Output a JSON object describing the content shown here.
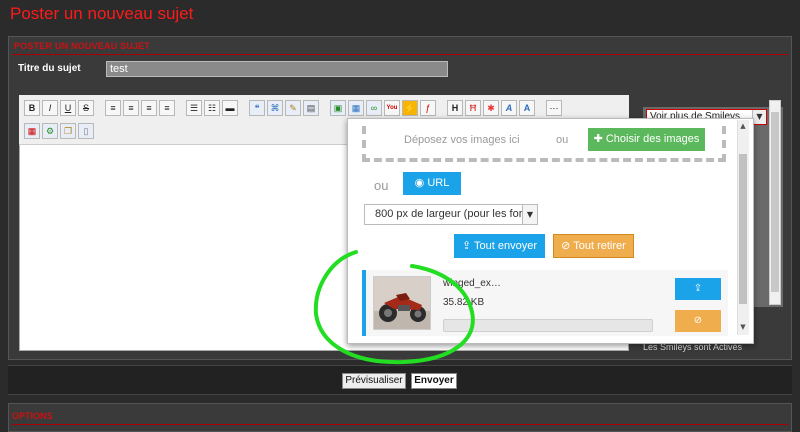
{
  "header": {
    "title": "Poster un nouveau sujet"
  },
  "post_section": {
    "heading": "POSTER UN NOUVEAU SUJET"
  },
  "subject": {
    "label": "Titre du sujet",
    "value": "test"
  },
  "toolbar": {
    "row1": [
      "B",
      "I",
      "U",
      "S",
      "align-left",
      "align-center",
      "align-right",
      "justify",
      "bulleted-list",
      "numbered-list",
      "horizontal-rule",
      "quote",
      "code",
      "spoiler",
      "hide",
      "image",
      "host-image",
      "link",
      "youtube",
      "flash",
      "dailymotion",
      "H",
      "table",
      "color",
      "A",
      "font-size",
      "more"
    ],
    "row2": [
      "date",
      "gadgets",
      "copy-paste",
      "new-doc"
    ]
  },
  "smileys": {
    "select_label": "Voir plus de Smileys",
    "disabled_text": "Les Smileys sont Activés"
  },
  "upload": {
    "drop_text": "Déposez vos images ici",
    "drop_or": "ou",
    "choose_button": "Choisir des images",
    "or_label": "ou",
    "url_button": "URL",
    "size_option": "800 px de largeur (pour les for",
    "send_all_button": "Tout envoyer",
    "remove_all_button": "Tout retirer",
    "file": {
      "name": "winged_ex…",
      "size": "35.82 KB",
      "progress": 0
    }
  },
  "actions": {
    "preview_button": "Prévisualiser",
    "send_button": "Envoyer"
  },
  "options_section": {
    "heading": "OPTIONS"
  },
  "colors": {
    "accent_red": "#cc1111",
    "blue": "#1aa3e8",
    "green": "#5cb85c",
    "orange": "#f0ad4e"
  }
}
